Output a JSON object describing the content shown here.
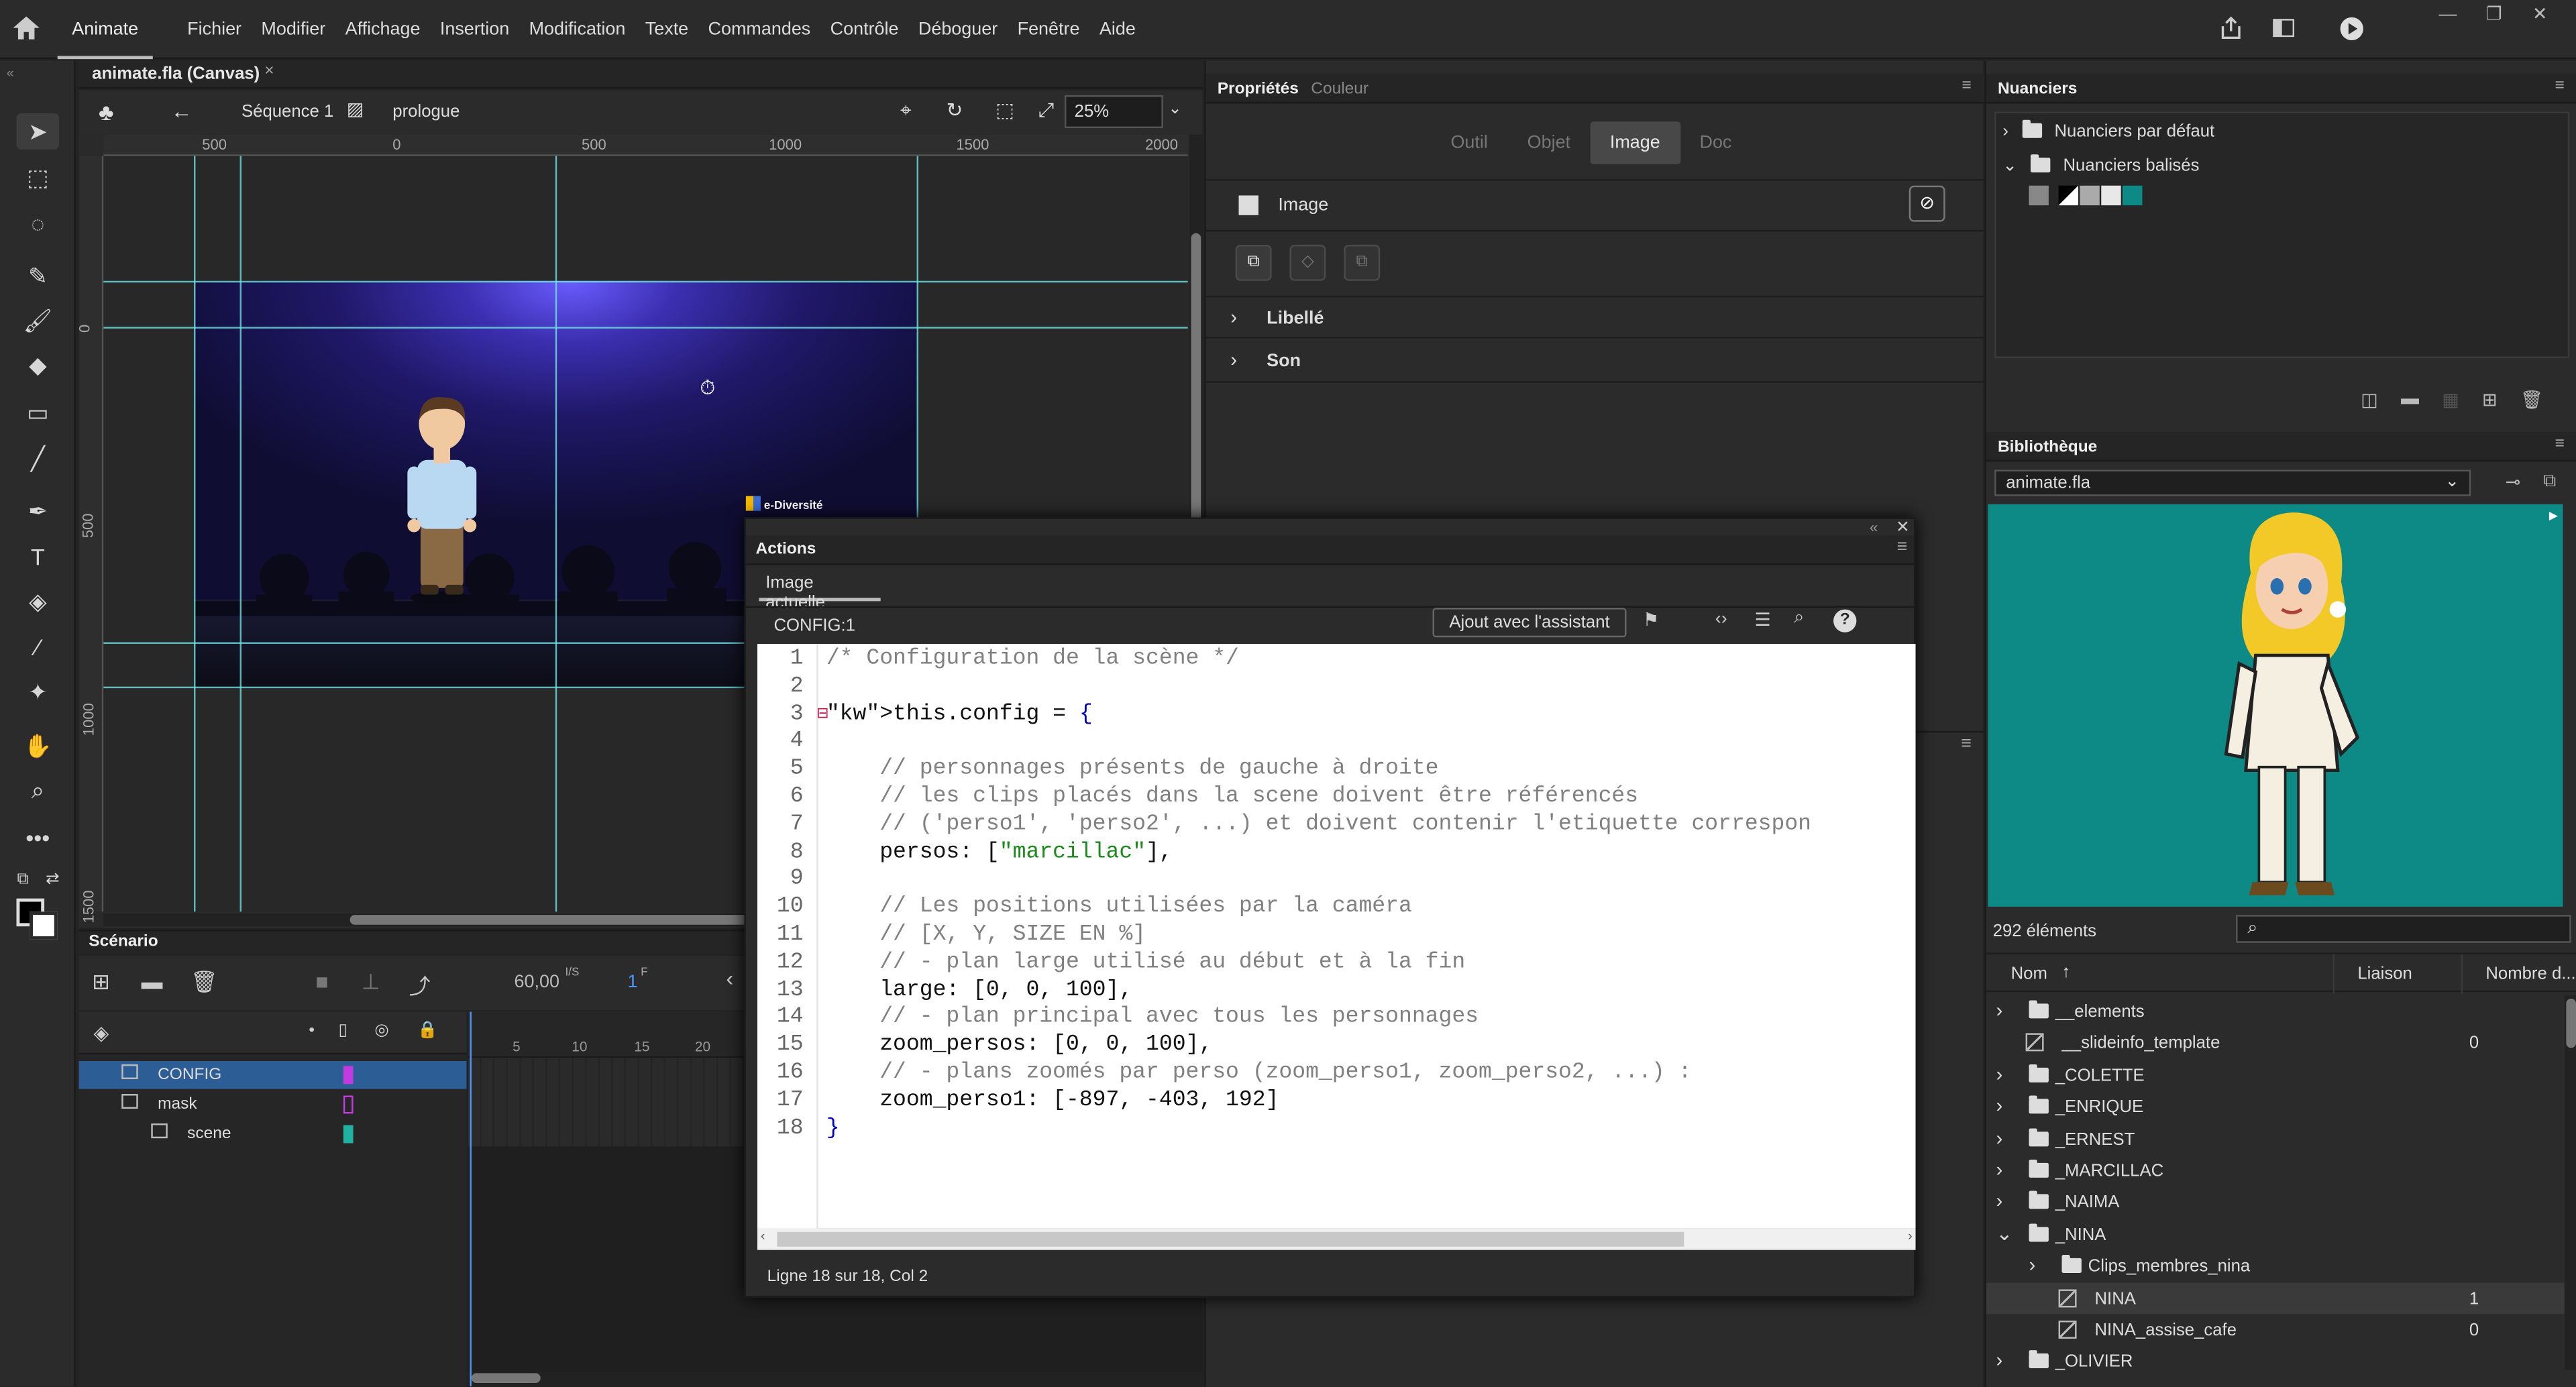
{
  "app": {
    "name": "Animate"
  },
  "menu": [
    "Fichier",
    "Modifier",
    "Affichage",
    "Insertion",
    "Modification",
    "Texte",
    "Commandes",
    "Contrôle",
    "Déboguer",
    "Fenêtre",
    "Aide"
  ],
  "document": {
    "tab_title": "animate.fla (Canvas)",
    "close": "×"
  },
  "editbar": {
    "scene": "Séquence 1",
    "symbol": "prologue",
    "zoom": "25%"
  },
  "ruler": {
    "h": [
      "500",
      "0",
      "500",
      "1000",
      "1500",
      "2000"
    ],
    "v": [
      "0",
      "500",
      "1000",
      "1500"
    ]
  },
  "stage_logo": "e-Diversité",
  "scenario": {
    "title": "Scénario",
    "fps": "60,00",
    "fps_unit": "I/S",
    "frame": "1",
    "frame_unit": "F",
    "frame_ticks": [
      "5",
      "10",
      "15",
      "20"
    ],
    "layers": [
      {
        "name": "CONFIG",
        "color": "#c23be0",
        "selected": true
      },
      {
        "name": "mask",
        "color": "#c23be0",
        "selected": false
      },
      {
        "name": "scene",
        "color": "#20b2a0",
        "selected": false
      }
    ]
  },
  "properties": {
    "tab_props": "Propriétés",
    "tab_color": "Couleur",
    "segments": [
      "Outil",
      "Objet",
      "Image",
      "Doc"
    ],
    "active_segment": "Image",
    "image_label": "Image",
    "sections": [
      "Libellé",
      "Son"
    ]
  },
  "actions": {
    "title": "Actions",
    "tab": "Image actuelle",
    "target": "CONFIG:1",
    "assistant_button": "Ajout avec l'assistant",
    "status": "Ligne 18 sur 18, Col 2",
    "code": [
      "/* Configuration de la scène */",
      "",
      "this.config = {",
      "",
      "    // personnages présents de gauche à droite",
      "    // les clips placés dans la scene doivent être référencés",
      "    // ('perso1', 'perso2', ...) et doivent contenir l'etiquette correspon",
      "    persos: [\"marcillac\"],",
      "",
      "    // Les positions utilisées par la caméra",
      "    // [X, Y, SIZE EN %]",
      "    // - plan large utilisé au début et à la fin",
      "    large: [0, 0, 100],",
      "    // - plan principal avec tous les personnages",
      "    zoom_persos: [0, 0, 100],",
      "    // - plans zoomés par perso (zoom_perso1, zoom_perso2, ...) :",
      "    zoom_perso1: [-897, -403, 192]",
      "}"
    ]
  },
  "swatches": {
    "title": "Nuanciers",
    "items": [
      "Nuanciers par défaut",
      "Nuanciers balisés"
    ]
  },
  "library": {
    "title": "Bibliothèque",
    "file": "animate.fla",
    "count": "292 éléments",
    "col_name": "Nom",
    "col_link": "Liaison",
    "col_count": "Nombre d...",
    "items": [
      {
        "name": "__elements",
        "type": "folder",
        "open": false,
        "count": "",
        "indent": 0
      },
      {
        "name": "__slideinfo_template",
        "type": "symbol",
        "open": false,
        "count": "0",
        "indent": 0
      },
      {
        "name": "_COLETTE",
        "type": "folder",
        "open": false,
        "count": "",
        "indent": 0
      },
      {
        "name": "_ENRIQUE",
        "type": "folder",
        "open": false,
        "count": "",
        "indent": 0
      },
      {
        "name": "_ERNEST",
        "type": "folder",
        "open": false,
        "count": "",
        "indent": 0
      },
      {
        "name": "_MARCILLAC",
        "type": "folder",
        "open": false,
        "count": "",
        "indent": 0
      },
      {
        "name": "_NAIMA",
        "type": "folder",
        "open": false,
        "count": "",
        "indent": 0
      },
      {
        "name": "_NINA",
        "type": "folder",
        "open": true,
        "count": "",
        "indent": 0
      },
      {
        "name": "Clips_membres_nina",
        "type": "folder",
        "open": false,
        "count": "",
        "indent": 1
      },
      {
        "name": "NINA",
        "type": "symbol",
        "open": false,
        "count": "1",
        "indent": 1
      },
      {
        "name": "NINA_assise_cafe",
        "type": "symbol",
        "open": false,
        "count": "0",
        "indent": 1
      },
      {
        "name": "_OLIVIER",
        "type": "folder",
        "open": false,
        "count": "",
        "indent": 0
      }
    ]
  },
  "colors": {
    "accent": "#2c5d94",
    "guide": "#6ee1e1",
    "library_preview_bg": "#0d8a86"
  }
}
